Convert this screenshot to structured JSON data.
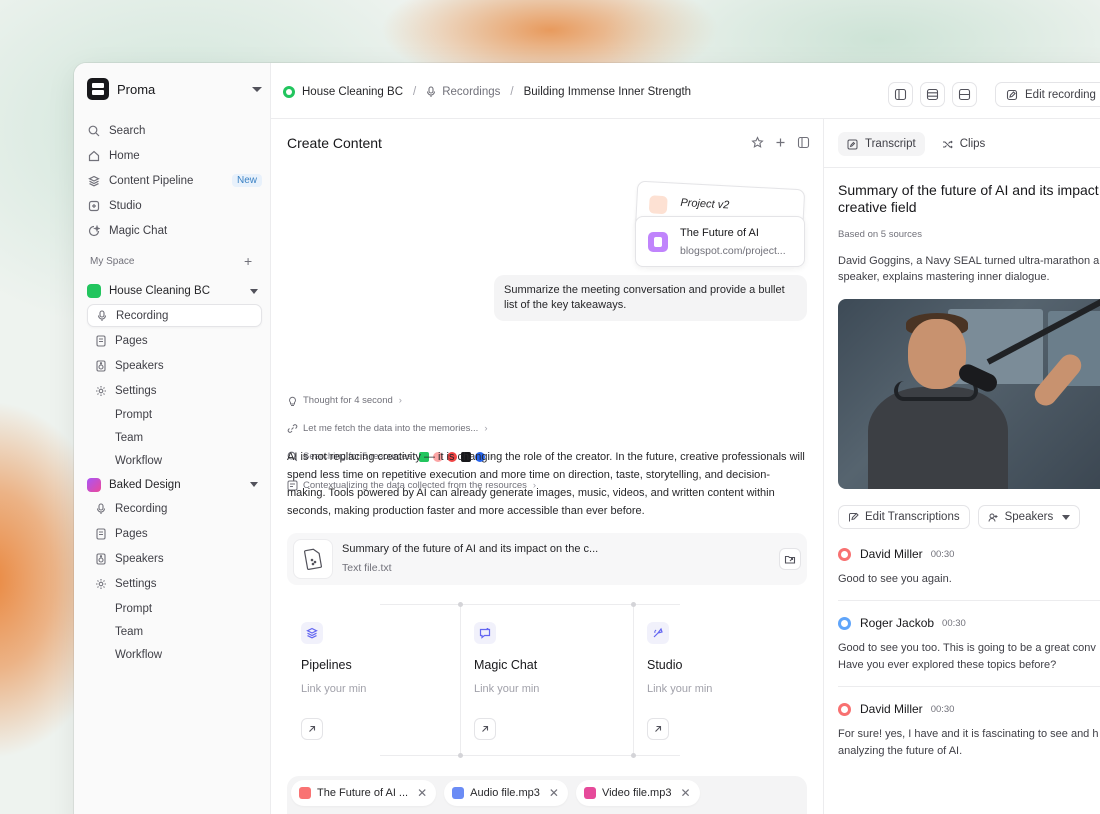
{
  "app": {
    "name": "Proma"
  },
  "sidebar": {
    "nav": [
      {
        "label": "Search",
        "icon": "search-icon"
      },
      {
        "label": "Home",
        "icon": "home-icon"
      },
      {
        "label": "Content Pipeline",
        "icon": "layers-icon",
        "badge": "New"
      },
      {
        "label": "Studio",
        "icon": "studio-icon"
      },
      {
        "label": "Magic Chat",
        "icon": "chat-icon"
      }
    ],
    "section_label": "My Space",
    "workspaces": [
      {
        "name": "House Cleaning BC",
        "color": "#22c55e",
        "items": [
          "Recording",
          "Pages",
          "Speakers",
          "Settings"
        ],
        "settings_children": [
          "Prompt",
          "Team",
          "Workflow"
        ]
      },
      {
        "name": "Baked Design",
        "color": "#a855f7",
        "items": [
          "Recording",
          "Pages",
          "Speakers",
          "Settings"
        ],
        "settings_children": [
          "Prompt",
          "Team",
          "Workflow"
        ]
      }
    ]
  },
  "topbar": {
    "breadcrumb": [
      "House Cleaning BC",
      "Recordings",
      "Building Immense Inner Strength"
    ],
    "edit_label": "Edit recording"
  },
  "main": {
    "title": "Create Content",
    "attachments": {
      "back_title": "Project v2",
      "front_title": "The Future of AI",
      "front_sub": "blogspot.com/project..."
    },
    "user_message": "Summarize the meeting conversation and provide a bullet list of the key takeaways.",
    "steps": [
      "Thought for 4 second",
      "Let me fetch the data into the memories...",
      "Searching for 5 resources",
      "Contextualizing the data collected from the resources"
    ],
    "answer": "AI is not replacing creativity — it is changing the role of the creator. In the future, creative professionals will spend less time on repetitive execution and more time on direction, taste, storytelling, and decision-making. Tools powered by AI can already generate images, music, videos, and written content within seconds, making production faster and more accessible than ever before.",
    "file": {
      "title": "Summary of the future of AI and its impact on the c...",
      "sub": "Text file.txt"
    },
    "features": [
      {
        "name": "Pipelines",
        "desc": "Link your min",
        "icon": "layers-icon"
      },
      {
        "name": "Magic Chat",
        "desc": "Link your min",
        "icon": "chat-icon"
      },
      {
        "name": "Studio",
        "desc": "Link your min",
        "icon": "studio-icon"
      }
    ],
    "chips": [
      {
        "label": "The Future of AI ...",
        "color": "#f97373"
      },
      {
        "label": "Audio file.mp3",
        "color": "#6b8cf5"
      },
      {
        "label": "Video file.mp3",
        "color": "#e64a9a"
      }
    ]
  },
  "right": {
    "tabs": [
      "Transcript",
      "Clips"
    ],
    "title": "Summary of the future of AI and its impact\ncreative field",
    "based": "Based on 5 sources",
    "summary": "David Goggins, a Navy SEAL turned ultra-marathon a\nspeaker, explains mastering inner dialogue.",
    "buttons": {
      "edit": "Edit Transcriptions",
      "speakers": "Speakers"
    },
    "messages": [
      {
        "name": "David Miller",
        "time": "00:30",
        "text": "Good to see you again.",
        "color": "#f87171"
      },
      {
        "name": "Roger Jackob",
        "time": "00:30",
        "text": "Good to see you too. This is going to be a great conv\nHave you ever explored these topics before?",
        "color": "#60a5fa"
      },
      {
        "name": "David Miller",
        "time": "00:30",
        "text": "For sure! yes, I have and it is fascinating to see and h\nanalyzing the future of AI.",
        "color": "#f87171"
      }
    ]
  }
}
